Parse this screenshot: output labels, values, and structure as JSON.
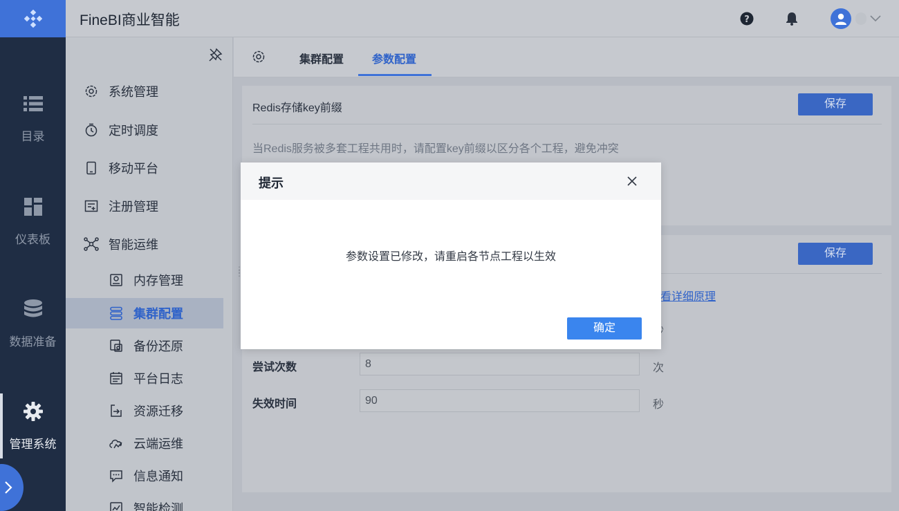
{
  "header": {
    "app_title": "FineBI商业智能",
    "help_icon": "help-icon",
    "bell_icon": "bell-icon",
    "avatar_icon": "user-icon"
  },
  "rail": {
    "items": [
      {
        "label": "目录",
        "icon": "list-icon"
      },
      {
        "label": "仪表板",
        "icon": "dashboard-icon"
      },
      {
        "label": "数据准备",
        "icon": "database-icon"
      },
      {
        "label": "管理系统",
        "icon": "gear-icon",
        "active": true
      }
    ]
  },
  "subnav": {
    "items": [
      {
        "label": "系统管理",
        "icon": "settings-icon"
      },
      {
        "label": "定时调度",
        "icon": "timer-icon"
      },
      {
        "label": "移动平台",
        "icon": "tablet-icon"
      },
      {
        "label": "注册管理",
        "icon": "register-icon"
      },
      {
        "label": "智能运维",
        "icon": "network-icon"
      },
      {
        "label": "内存管理",
        "icon": "memory-icon"
      },
      {
        "label": "集群配置",
        "icon": "cluster-icon",
        "active": true
      },
      {
        "label": "备份还原",
        "icon": "backup-icon"
      },
      {
        "label": "平台日志",
        "icon": "calendar-log-icon"
      },
      {
        "label": "资源迁移",
        "icon": "migrate-icon"
      },
      {
        "label": "云端运维",
        "icon": "cloud-icon"
      },
      {
        "label": "信息通知",
        "icon": "message-icon"
      },
      {
        "label": "智能检测",
        "icon": "detect-icon"
      }
    ]
  },
  "tabs": {
    "items": [
      {
        "label": "集群配置"
      },
      {
        "label": "参数配置",
        "active": true
      }
    ]
  },
  "card1": {
    "title": "Redis存储key前缀",
    "save_label": "保存",
    "description": "当Redis服务被多套工程共用时，请配置key前缀以区分各个工程，避免冲突"
  },
  "card2": {
    "save_label": "保存",
    "link_text": "看详细原理",
    "unit_partial": "秒",
    "fields": [
      {
        "label": "尝试次数",
        "value": "8",
        "unit": "次"
      },
      {
        "label": "失效时间",
        "value": "90",
        "unit": "秒"
      }
    ]
  },
  "modal": {
    "title": "提示",
    "message": "参数设置已修改，请重启各节点工程以生效",
    "ok_label": "确定"
  },
  "colors": {
    "accent": "#3f72d8",
    "rail_bg": "#1f2d44",
    "modal_ok": "#3a85ee"
  }
}
